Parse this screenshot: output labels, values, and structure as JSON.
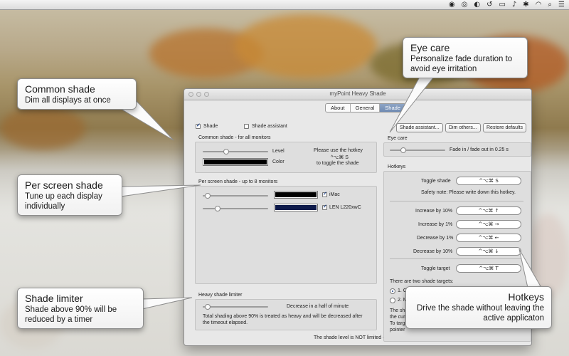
{
  "menubar": {
    "icons": [
      "record-icon",
      "target-icon",
      "shade-icon",
      "history-icon",
      "display-icon",
      "volume-icon",
      "bluetooth-icon",
      "wifi-icon",
      "spotlight-icon",
      "menu-list-icon"
    ]
  },
  "window": {
    "title": "myPoint Heavy Shade",
    "tabs": [
      {
        "label": "About",
        "active": false
      },
      {
        "label": "General",
        "active": false
      },
      {
        "label": "Shade",
        "active": true
      }
    ]
  },
  "shade": {
    "shade_checkbox": "Shade",
    "shade_checked": true,
    "assistant_checkbox": "Shade assistant",
    "assistant_checked": false
  },
  "common": {
    "title": "Common shade - for all monitors",
    "level_label": "Level",
    "color_label": "Color",
    "level_value": 0.35,
    "hotkey_note_line1": "Please use the hotkey",
    "hotkey_note_line2": "^⌥⌘ S",
    "hotkey_note_line3": "to toggle the shade"
  },
  "per_screen": {
    "title": "Per screen shade - up to 8 monitors",
    "monitors": [
      {
        "name": "iMac",
        "checked": true,
        "color": "#000000",
        "level": 0.04
      },
      {
        "name": "LEN L220xwC",
        "checked": true,
        "color": "#0d1a4a",
        "level": 0.2
      }
    ]
  },
  "limiter": {
    "title": "Heavy shade limiter",
    "slider_label": "Decrease in a half of minute",
    "slider_value": 0.04,
    "note": "Total shading above 90% is treated as heavy and will be decreased after the timeout elapsed."
  },
  "footer": {
    "status": "The shade level is NOT limited - it can hit 100%."
  },
  "right": {
    "buttons": [
      "Shade assistant...",
      "Dim others...",
      "Restore defaults"
    ],
    "eye_care_title": "Eye care",
    "eye_care_label": "Fade in / fade out in 0.25 s",
    "eye_care_value": 0.22,
    "hotkeys_title": "Hotkeys",
    "toggle_shade_label": "Toggle shade",
    "toggle_shade_key": "^⌥⌘ S",
    "safety_note": "Safety note: Please write down this hotkey.",
    "rows": [
      {
        "label": "Increase by 10%",
        "key": "^⌥⌘ ↑"
      },
      {
        "label": "Increase by 1%",
        "key": "^⌥⌘ →"
      },
      {
        "label": "Decrease by 1%",
        "key": "^⌥⌘ ←"
      },
      {
        "label": "Decrease by 10%",
        "key": "^⌥⌘ ↓"
      }
    ],
    "toggle_target_label": "Toggle target",
    "toggle_target_key": "^⌥⌘ T",
    "targets_text": "There are two shade targets:",
    "target1": "1. C",
    "target2": "2. M",
    "tail1": "The sha",
    "tail2": "the curr",
    "tail3": "To targ",
    "tail4": "pointer"
  },
  "callouts": {
    "eye_care": {
      "title": "Eye care",
      "desc": "Personalize fade duration to avoid eye irritation"
    },
    "common_shade": {
      "title": "Common shade",
      "desc": "Dim all displays at once"
    },
    "per_screen": {
      "title": "Per screen shade",
      "desc": "Tune up each display individually"
    },
    "limiter": {
      "title": "Shade limiter",
      "desc": "Shade above 90% will be reduced by a timer"
    },
    "hotkeys": {
      "title": "Hotkeys",
      "desc": "Drive the shade without leaving the active applicaton"
    }
  }
}
